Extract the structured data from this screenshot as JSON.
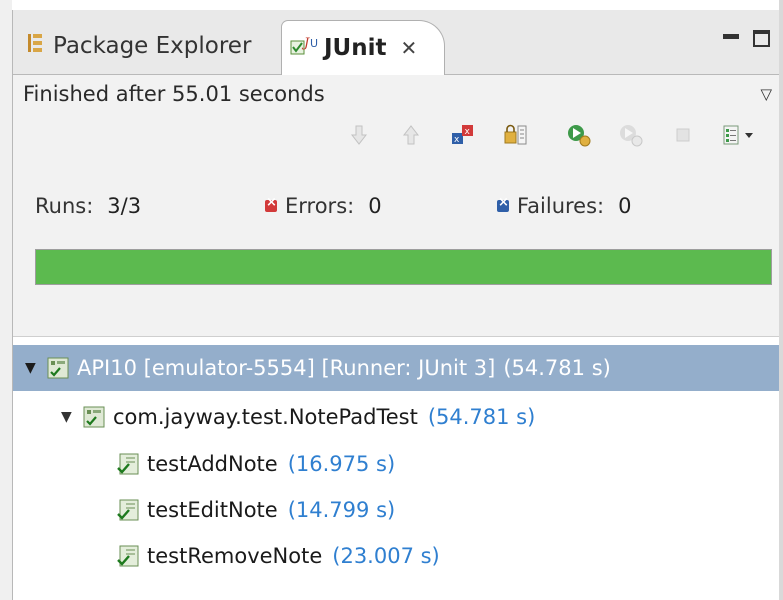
{
  "tabs": [
    {
      "label": "Package Explorer",
      "icon": "package-explorer-icon"
    },
    {
      "label": "JUnit",
      "icon": "junit-icon",
      "active": true
    }
  ],
  "status": {
    "text": "Finished after 55.01 seconds"
  },
  "counters": {
    "runs_label": "Runs:",
    "runs_value": "3/3",
    "errors_label": "Errors:",
    "errors_value": "0",
    "failures_label": "Failures:",
    "failures_value": "0"
  },
  "progress": {
    "fraction": 1.0,
    "color": "#5cba4f"
  },
  "tree": {
    "root": {
      "label": "API10 [emulator-5554] [Runner: JUnit 3]",
      "time": "(54.781 s)"
    },
    "suite": {
      "label": "com.jayway.test.NotePadTest",
      "time": "(54.781 s)"
    },
    "tests": [
      {
        "label": "testAddNote",
        "time": "(16.975 s)"
      },
      {
        "label": "testEditNote",
        "time": "(14.799 s)"
      },
      {
        "label": "testRemoveNote",
        "time": "(23.007 s)"
      }
    ]
  },
  "colors": {
    "selection": "#94aecb",
    "time": "#2f7fd0",
    "error": "#d23a3a",
    "failure": "#2f5fa8"
  }
}
